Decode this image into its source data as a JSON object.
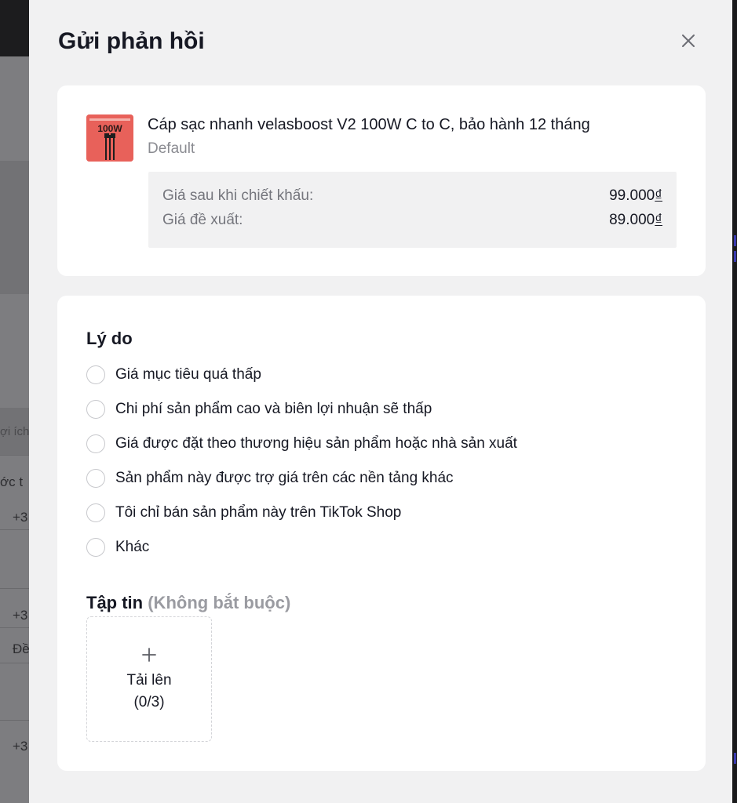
{
  "background": {
    "fragments": [
      "ợi ích",
      "ớc t",
      "+3",
      "+3",
      "Đề",
      "+3"
    ]
  },
  "drawer": {
    "title": "Gửi phản hồi",
    "close_icon": "close-icon"
  },
  "product": {
    "thumbnail_text": "100W",
    "name": "Cáp sạc nhanh velasboost V2 100W C to C, bảo hành 12 tháng",
    "variant": "Default",
    "prices": [
      {
        "label": "Giá sau khi chiết khấu:",
        "amount": "99.000",
        "currency": "₫"
      },
      {
        "label": "Giá đề xuất:",
        "amount": "89.000",
        "currency": "₫"
      }
    ]
  },
  "reason": {
    "title": "Lý do",
    "options": [
      {
        "label": "Giá mục tiêu quá thấp",
        "selected": false
      },
      {
        "label": "Chi phí sản phẩm cao và biên lợi nhuận sẽ thấp",
        "selected": false
      },
      {
        "label": "Giá được đặt theo thương hiệu sản phẩm hoặc nhà sản xuất",
        "selected": false
      },
      {
        "label": "Sản phẩm này được trợ giá trên các nền tảng khác",
        "selected": false
      },
      {
        "label": "Tôi chỉ bán sản phẩm này trên TikTok Shop",
        "selected": false
      },
      {
        "label": "Khác",
        "selected": false
      }
    ]
  },
  "files": {
    "title": "Tập tin",
    "optional_note": "(Không bắt buộc)",
    "upload_icon": "plus-icon",
    "upload_label": "Tải lên",
    "upload_count": "(0/3)"
  }
}
